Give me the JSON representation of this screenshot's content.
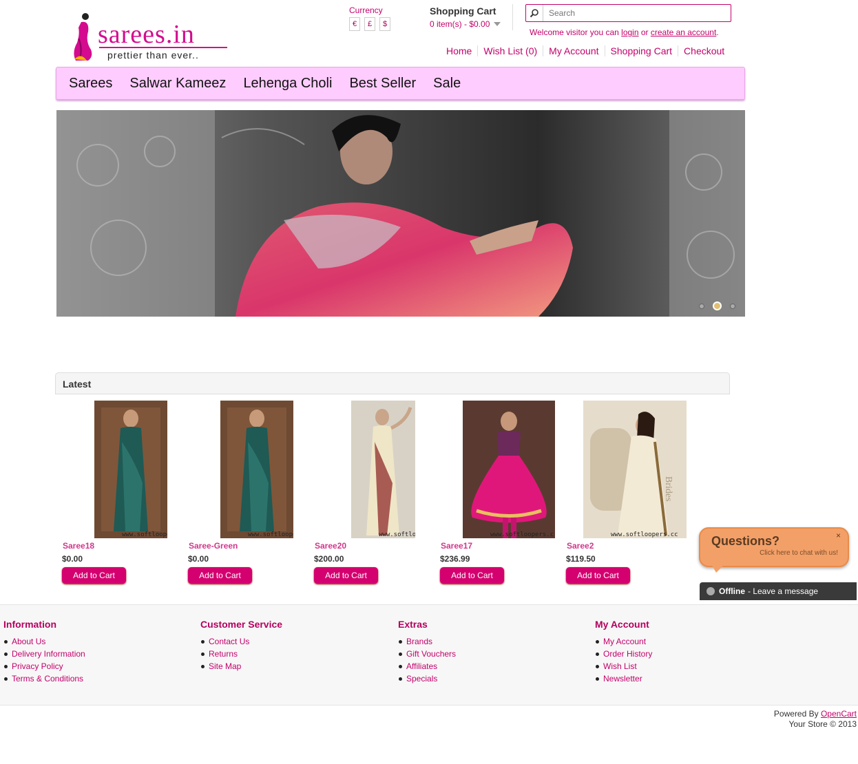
{
  "header": {
    "logo_text": "sarees.in",
    "logo_tagline": "prettier than ever..",
    "currency_label": "Currency",
    "currencies": [
      "€",
      "£",
      "$"
    ],
    "cart_title": "Shopping Cart",
    "cart_summary": "0 item(s) - $0.00",
    "search_placeholder": "Search",
    "welcome_prefix": "Welcome visitor you can",
    "welcome_login": "login",
    "welcome_or": "or",
    "welcome_register": "create an account",
    "welcome_suffix": ".",
    "links": [
      "Home",
      "Wish List (0)",
      "My Account",
      "Shopping Cart",
      "Checkout"
    ]
  },
  "menu": [
    "Sarees",
    "Salwar Kameez",
    "Lehenga Choli",
    "Best Seller",
    "Sale"
  ],
  "banner": {
    "slide_count": 3,
    "active_slide": 2
  },
  "latest": {
    "title": "Latest",
    "button_label": "Add to Cart",
    "products": [
      {
        "name": "Saree18",
        "price": "$0.00",
        "watermark": "www.softloopers.c"
      },
      {
        "name": "Saree-Green",
        "price": "$0.00",
        "watermark": "www.softloopers.c"
      },
      {
        "name": "Saree20",
        "price": "$200.00",
        "watermark": "www.softloopers.c"
      },
      {
        "name": "Saree17",
        "price": "$236.99",
        "watermark": "www.softloopers.c"
      },
      {
        "name": "Saree2",
        "price": "$119.50",
        "watermark": "www.softloopers.cc"
      }
    ]
  },
  "chat": {
    "title": "Questions?",
    "subtitle": "Click here to chat with us!",
    "close": "×",
    "status": "Offline",
    "status_message": "- Leave a message"
  },
  "footer": {
    "columns": [
      {
        "title": "Information",
        "items": [
          "About Us",
          "Delivery Information",
          "Privacy Policy",
          "Terms & Conditions"
        ]
      },
      {
        "title": "Customer Service",
        "items": [
          "Contact Us",
          "Returns",
          "Site Map"
        ]
      },
      {
        "title": "Extras",
        "items": [
          "Brands",
          "Gift Vouchers",
          "Affiliates",
          "Specials"
        ]
      },
      {
        "title": "My Account",
        "items": [
          "My Account",
          "Order History",
          "Wish List",
          "Newsletter"
        ]
      }
    ],
    "powered_prefix": "Powered By",
    "powered_link": "OpenCart",
    "copyright": "Your Store © 2013"
  },
  "colors": {
    "brand": "#d40b8f",
    "menu_bg": "#ffccff",
    "button": "#d40070",
    "chat": "#f3a068"
  }
}
